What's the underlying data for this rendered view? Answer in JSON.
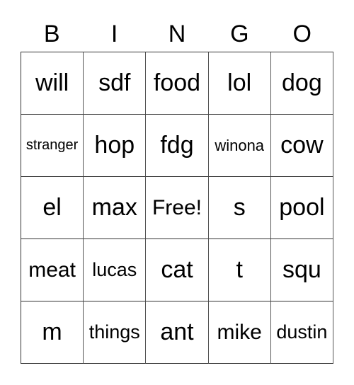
{
  "header": [
    "B",
    "I",
    "N",
    "G",
    "O"
  ],
  "cells": [
    [
      "will",
      "sdf",
      "food",
      "lol",
      "dog"
    ],
    [
      "stranger",
      "hop",
      "fdg",
      "winona",
      "cow"
    ],
    [
      "el",
      "max",
      "Free!",
      "s",
      "pool"
    ],
    [
      "meat",
      "lucas",
      "cat",
      "t",
      "squ"
    ],
    [
      "m",
      "things",
      "ant",
      "mike",
      "dustin"
    ]
  ]
}
